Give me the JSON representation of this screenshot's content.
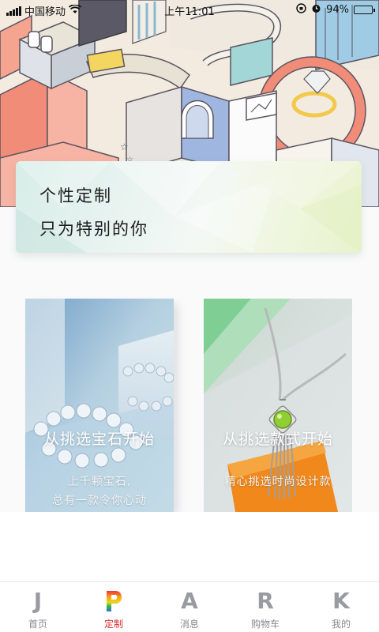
{
  "status_bar": {
    "carrier": "中国移动",
    "time": "上午11:01",
    "battery_text": "94%",
    "battery_level": 0.94,
    "icons": [
      "signal-icon",
      "wifi-icon",
      "orientation-lock-icon",
      "alarm-icon",
      "battery-icon"
    ]
  },
  "banner": {
    "line1": "个性定制",
    "line2": "只为特别的你"
  },
  "cards": [
    {
      "title": "从挑选宝石开始",
      "subtitle_lines": [
        "上千颗宝石,",
        "总有一款令你心动"
      ]
    },
    {
      "title": "从挑选款式开始",
      "subtitle_lines": [
        "精心挑选时尚设计款"
      ]
    }
  ],
  "tab_bar": {
    "active_index": 1,
    "active_color": "#d9302c",
    "items": [
      {
        "glyph": "J",
        "label": "首页",
        "icon": "home-icon"
      },
      {
        "glyph": "P",
        "label": "定制",
        "icon": "customize-icon"
      },
      {
        "glyph": "A",
        "label": "消息",
        "icon": "messages-icon"
      },
      {
        "glyph": "R",
        "label": "购物车",
        "icon": "cart-icon"
      },
      {
        "glyph": "K",
        "label": "我的",
        "icon": "profile-icon"
      }
    ]
  }
}
